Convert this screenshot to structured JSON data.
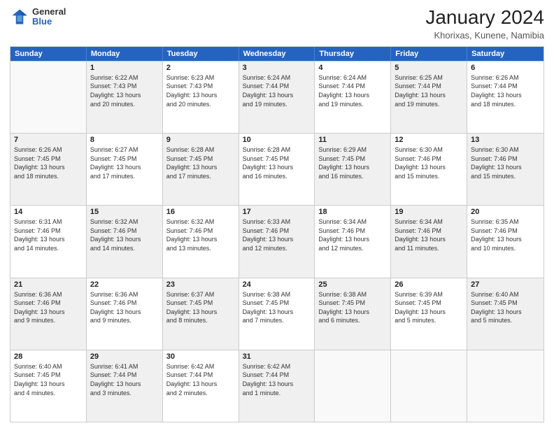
{
  "header": {
    "logo_general": "General",
    "logo_blue": "Blue",
    "title": "January 2024",
    "subtitle": "Khorixas, Kunene, Namibia"
  },
  "days_of_week": [
    "Sunday",
    "Monday",
    "Tuesday",
    "Wednesday",
    "Thursday",
    "Friday",
    "Saturday"
  ],
  "weeks": [
    [
      {
        "day": "",
        "info": ""
      },
      {
        "day": "1",
        "info": "Sunrise: 6:22 AM\nSunset: 7:43 PM\nDaylight: 13 hours\nand 20 minutes."
      },
      {
        "day": "2",
        "info": "Sunrise: 6:23 AM\nSunset: 7:43 PM\nDaylight: 13 hours\nand 20 minutes."
      },
      {
        "day": "3",
        "info": "Sunrise: 6:24 AM\nSunset: 7:44 PM\nDaylight: 13 hours\nand 19 minutes."
      },
      {
        "day": "4",
        "info": "Sunrise: 6:24 AM\nSunset: 7:44 PM\nDaylight: 13 hours\nand 19 minutes."
      },
      {
        "day": "5",
        "info": "Sunrise: 6:25 AM\nSunset: 7:44 PM\nDaylight: 13 hours\nand 19 minutes."
      },
      {
        "day": "6",
        "info": "Sunrise: 6:26 AM\nSunset: 7:44 PM\nDaylight: 13 hours\nand 18 minutes."
      }
    ],
    [
      {
        "day": "7",
        "info": "Sunrise: 6:26 AM\nSunset: 7:45 PM\nDaylight: 13 hours\nand 18 minutes."
      },
      {
        "day": "8",
        "info": "Sunrise: 6:27 AM\nSunset: 7:45 PM\nDaylight: 13 hours\nand 17 minutes."
      },
      {
        "day": "9",
        "info": "Sunrise: 6:28 AM\nSunset: 7:45 PM\nDaylight: 13 hours\nand 17 minutes."
      },
      {
        "day": "10",
        "info": "Sunrise: 6:28 AM\nSunset: 7:45 PM\nDaylight: 13 hours\nand 16 minutes."
      },
      {
        "day": "11",
        "info": "Sunrise: 6:29 AM\nSunset: 7:45 PM\nDaylight: 13 hours\nand 16 minutes."
      },
      {
        "day": "12",
        "info": "Sunrise: 6:30 AM\nSunset: 7:46 PM\nDaylight: 13 hours\nand 15 minutes."
      },
      {
        "day": "13",
        "info": "Sunrise: 6:30 AM\nSunset: 7:46 PM\nDaylight: 13 hours\nand 15 minutes."
      }
    ],
    [
      {
        "day": "14",
        "info": "Sunrise: 6:31 AM\nSunset: 7:46 PM\nDaylight: 13 hours\nand 14 minutes."
      },
      {
        "day": "15",
        "info": "Sunrise: 6:32 AM\nSunset: 7:46 PM\nDaylight: 13 hours\nand 14 minutes."
      },
      {
        "day": "16",
        "info": "Sunrise: 6:32 AM\nSunset: 7:46 PM\nDaylight: 13 hours\nand 13 minutes."
      },
      {
        "day": "17",
        "info": "Sunrise: 6:33 AM\nSunset: 7:46 PM\nDaylight: 13 hours\nand 12 minutes."
      },
      {
        "day": "18",
        "info": "Sunrise: 6:34 AM\nSunset: 7:46 PM\nDaylight: 13 hours\nand 12 minutes."
      },
      {
        "day": "19",
        "info": "Sunrise: 6:34 AM\nSunset: 7:46 PM\nDaylight: 13 hours\nand 11 minutes."
      },
      {
        "day": "20",
        "info": "Sunrise: 6:35 AM\nSunset: 7:46 PM\nDaylight: 13 hours\nand 10 minutes."
      }
    ],
    [
      {
        "day": "21",
        "info": "Sunrise: 6:36 AM\nSunset: 7:46 PM\nDaylight: 13 hours\nand 9 minutes."
      },
      {
        "day": "22",
        "info": "Sunrise: 6:36 AM\nSunset: 7:46 PM\nDaylight: 13 hours\nand 9 minutes."
      },
      {
        "day": "23",
        "info": "Sunrise: 6:37 AM\nSunset: 7:45 PM\nDaylight: 13 hours\nand 8 minutes."
      },
      {
        "day": "24",
        "info": "Sunrise: 6:38 AM\nSunset: 7:45 PM\nDaylight: 13 hours\nand 7 minutes."
      },
      {
        "day": "25",
        "info": "Sunrise: 6:38 AM\nSunset: 7:45 PM\nDaylight: 13 hours\nand 6 minutes."
      },
      {
        "day": "26",
        "info": "Sunrise: 6:39 AM\nSunset: 7:45 PM\nDaylight: 13 hours\nand 5 minutes."
      },
      {
        "day": "27",
        "info": "Sunrise: 6:40 AM\nSunset: 7:45 PM\nDaylight: 13 hours\nand 5 minutes."
      }
    ],
    [
      {
        "day": "28",
        "info": "Sunrise: 6:40 AM\nSunset: 7:45 PM\nDaylight: 13 hours\nand 4 minutes."
      },
      {
        "day": "29",
        "info": "Sunrise: 6:41 AM\nSunset: 7:44 PM\nDaylight: 13 hours\nand 3 minutes."
      },
      {
        "day": "30",
        "info": "Sunrise: 6:42 AM\nSunset: 7:44 PM\nDaylight: 13 hours\nand 2 minutes."
      },
      {
        "day": "31",
        "info": "Sunrise: 6:42 AM\nSunset: 7:44 PM\nDaylight: 13 hours\nand 1 minute."
      },
      {
        "day": "",
        "info": ""
      },
      {
        "day": "",
        "info": ""
      },
      {
        "day": "",
        "info": ""
      }
    ]
  ]
}
